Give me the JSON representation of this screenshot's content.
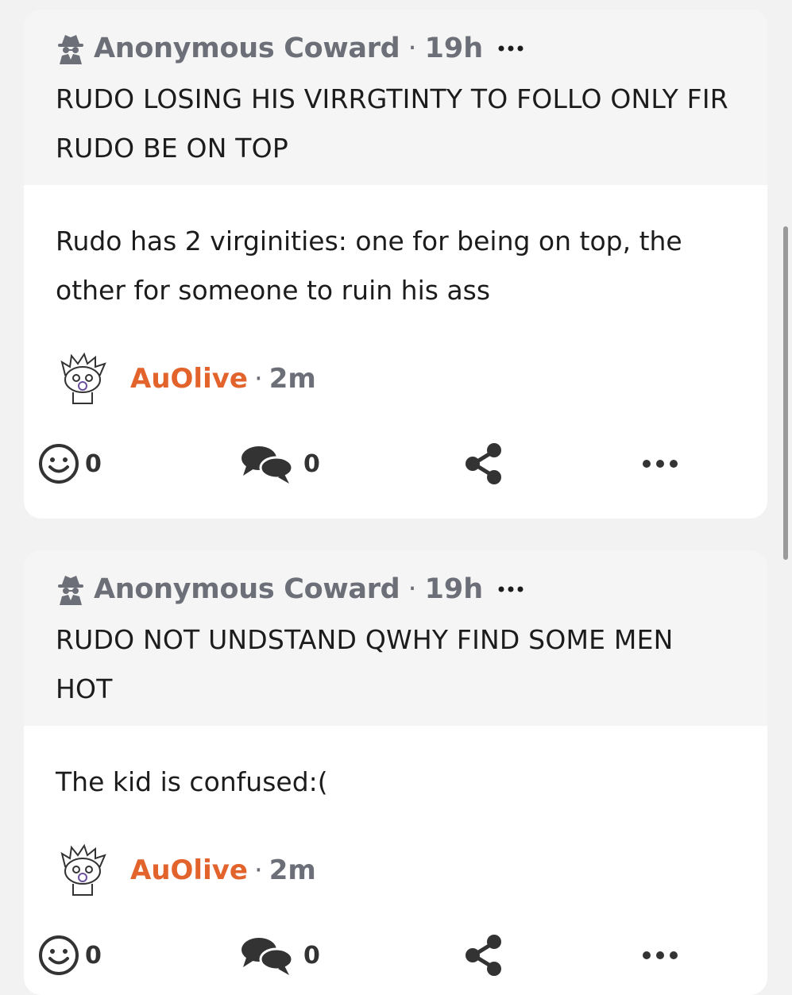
{
  "posts": [
    {
      "quote": {
        "author": "Anonymous Coward",
        "separator": "·",
        "time": "19h",
        "text": "RUDO LOSING HIS VIRRGTINTY TO FOLLO ONLY FIR RUDO BE ON TOP"
      },
      "reply": {
        "text": "Rudo has 2 virginities: one for being on top, the other for someone to ruin his ass",
        "username": "AuOlive",
        "separator": "·",
        "time": "2m"
      },
      "actions": {
        "reactions": "0",
        "comments": "0"
      }
    },
    {
      "quote": {
        "author": "Anonymous Coward",
        "separator": "·",
        "time": "19h",
        "text": "RUDO NOT UNDSTAND QWHY FIND SOME MEN HOT"
      },
      "reply": {
        "text": "The kid is confused:(",
        "username": "AuOlive",
        "separator": "·",
        "time": "2m"
      },
      "actions": {
        "reactions": "0",
        "comments": "0"
      }
    }
  ],
  "colors": {
    "accent_username": "#e3632d",
    "meta_gray": "#6d6f78",
    "icon_dark": "#3a3a3a"
  },
  "icons": {
    "anon": "spy-icon",
    "reaction": "smiley-icon",
    "comment": "comments-icon",
    "share": "share-icon",
    "more": "ellipsis-icon"
  }
}
